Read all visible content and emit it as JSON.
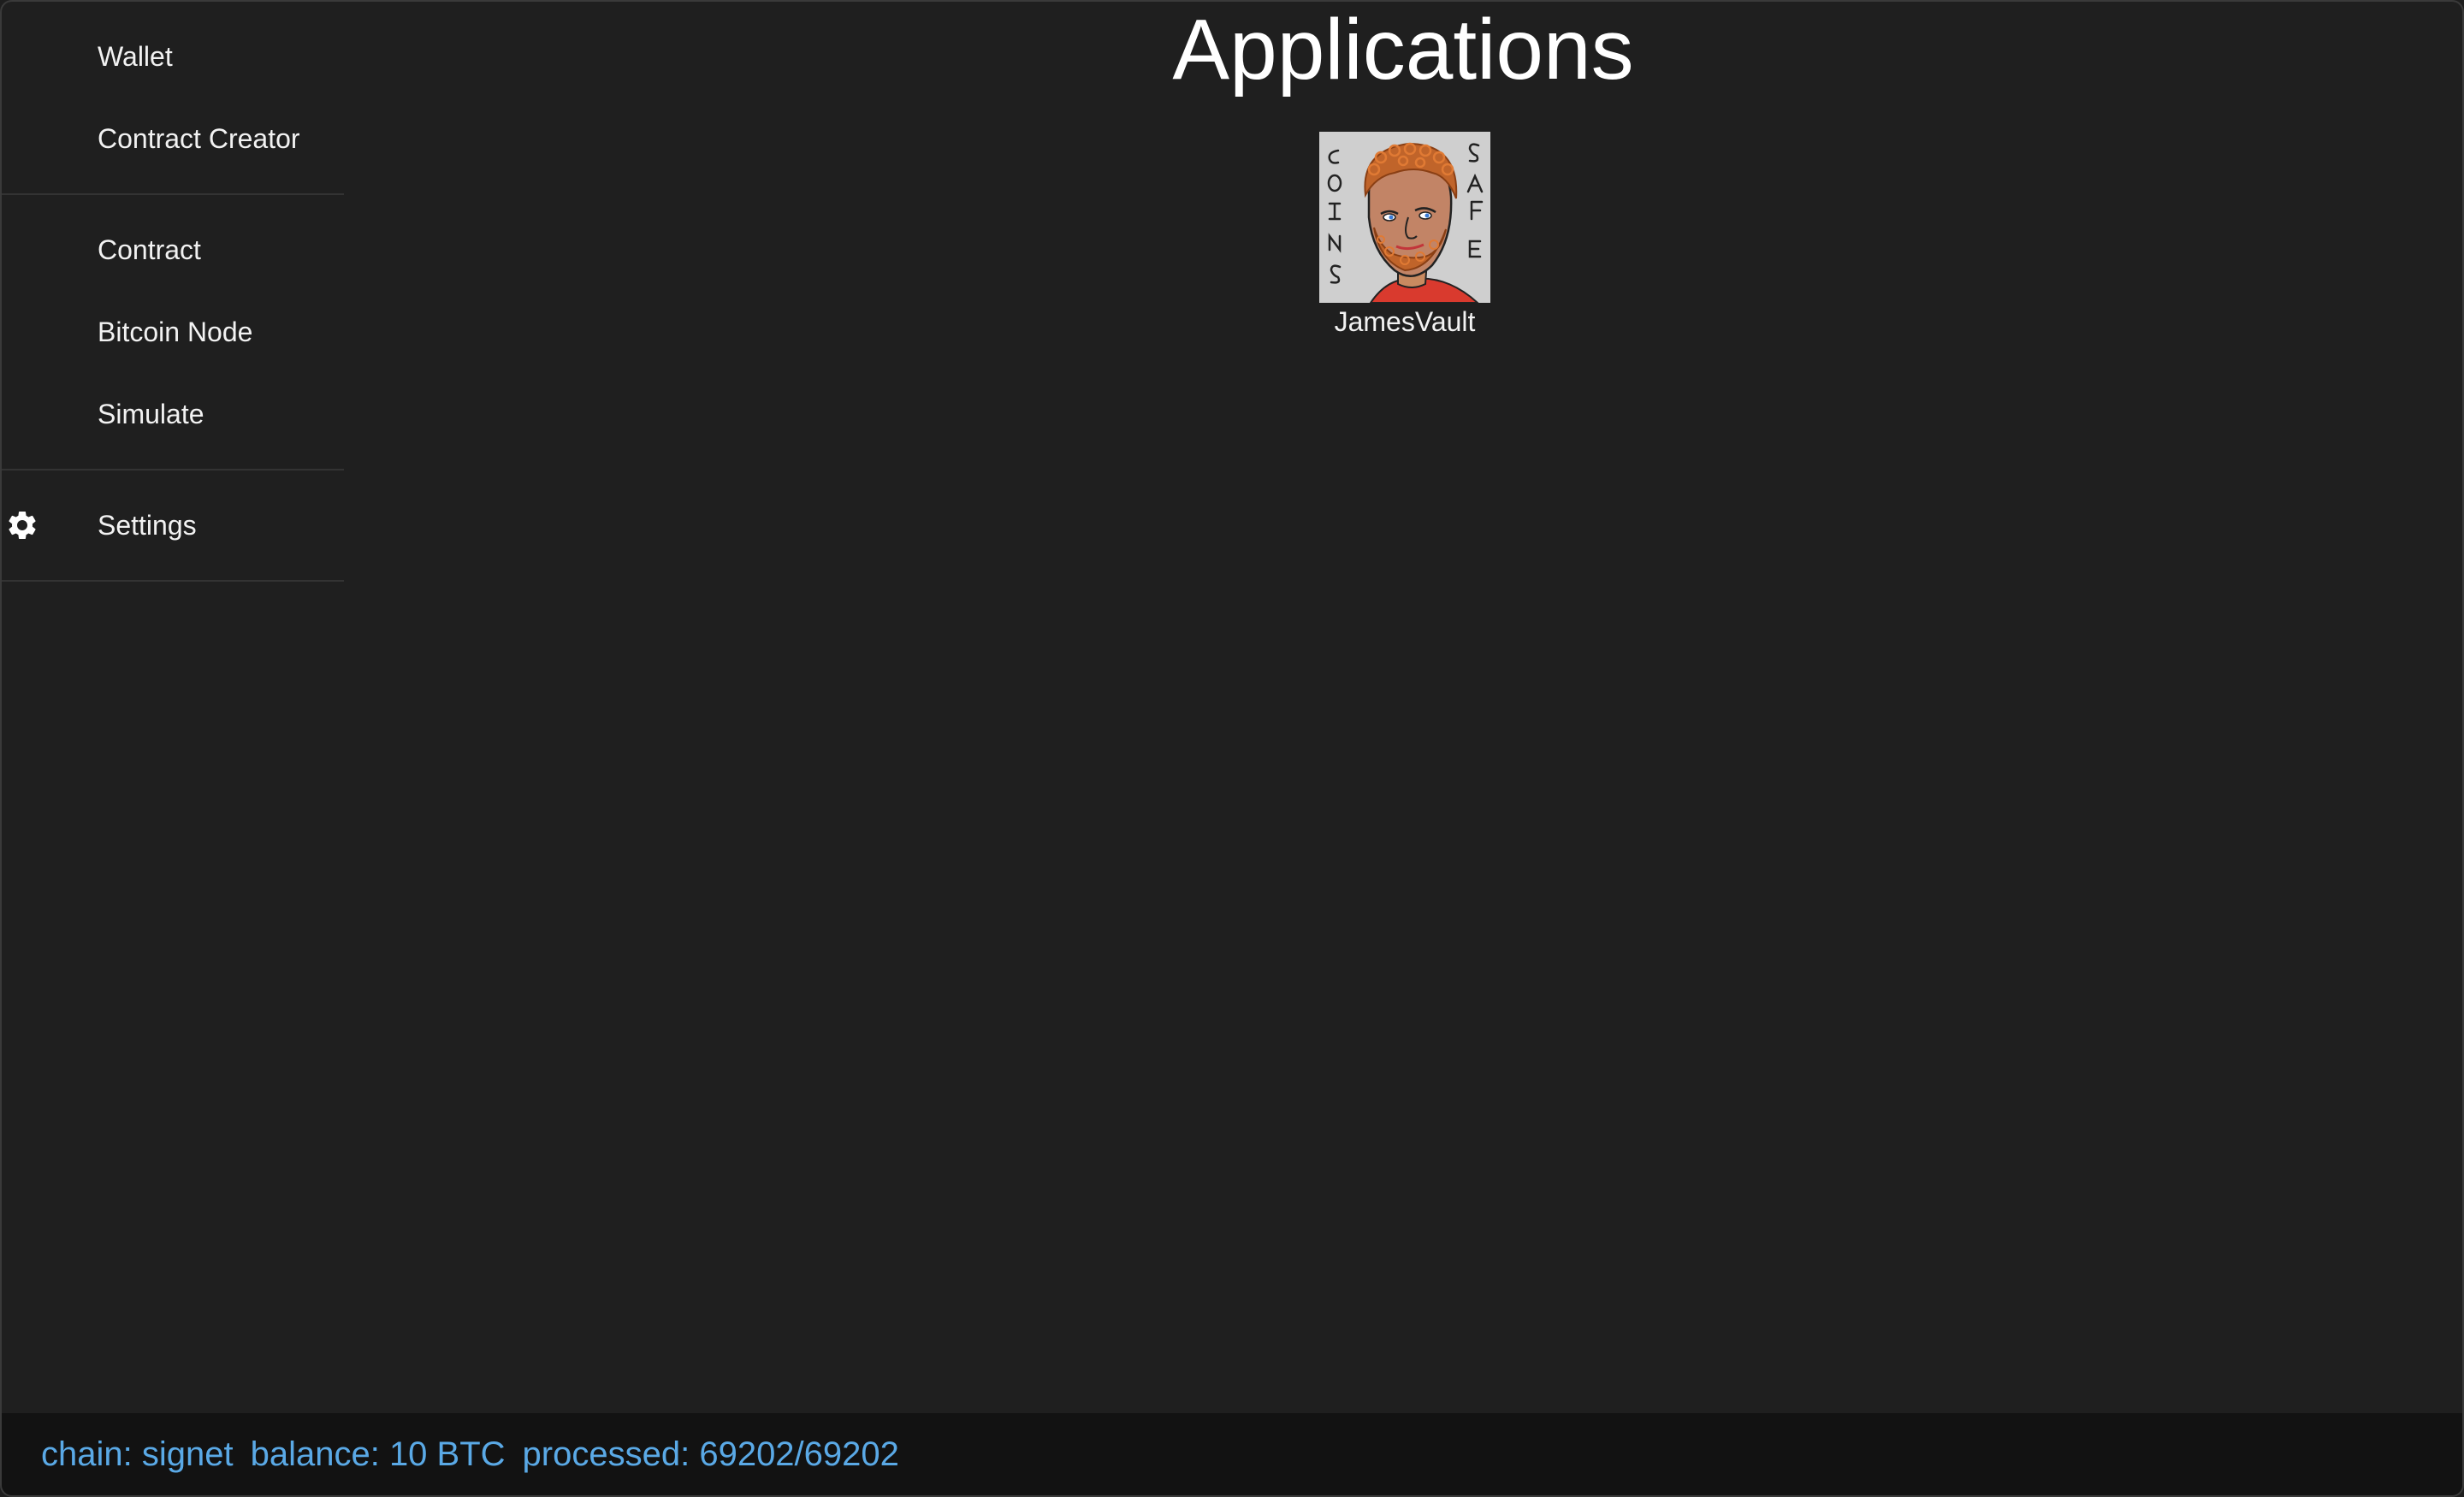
{
  "sidebar": {
    "groups": [
      {
        "items": [
          {
            "label": "Wallet"
          },
          {
            "label": "Contract Creator"
          }
        ]
      },
      {
        "items": [
          {
            "label": "Contract"
          },
          {
            "label": "Bitcoin Node"
          },
          {
            "label": "Simulate"
          }
        ]
      },
      {
        "items": [
          {
            "label": "Settings",
            "icon": "gear-icon"
          }
        ]
      }
    ]
  },
  "main": {
    "title": "Applications",
    "apps": [
      {
        "name": "JamesVault",
        "icon": "james-vault-logo",
        "logo_letters_left": "COINS",
        "logo_letters_right": "SAFE"
      }
    ]
  },
  "status": {
    "chain": "chain: signet",
    "balance": "balance: 10 BTC",
    "processed": "processed: 69202/69202"
  },
  "colors": {
    "background": "#1f1f1f",
    "statusbar_bg": "#121212",
    "status_text": "#5aa9e6",
    "text": "#f2f2f2",
    "divider": "#333333"
  }
}
